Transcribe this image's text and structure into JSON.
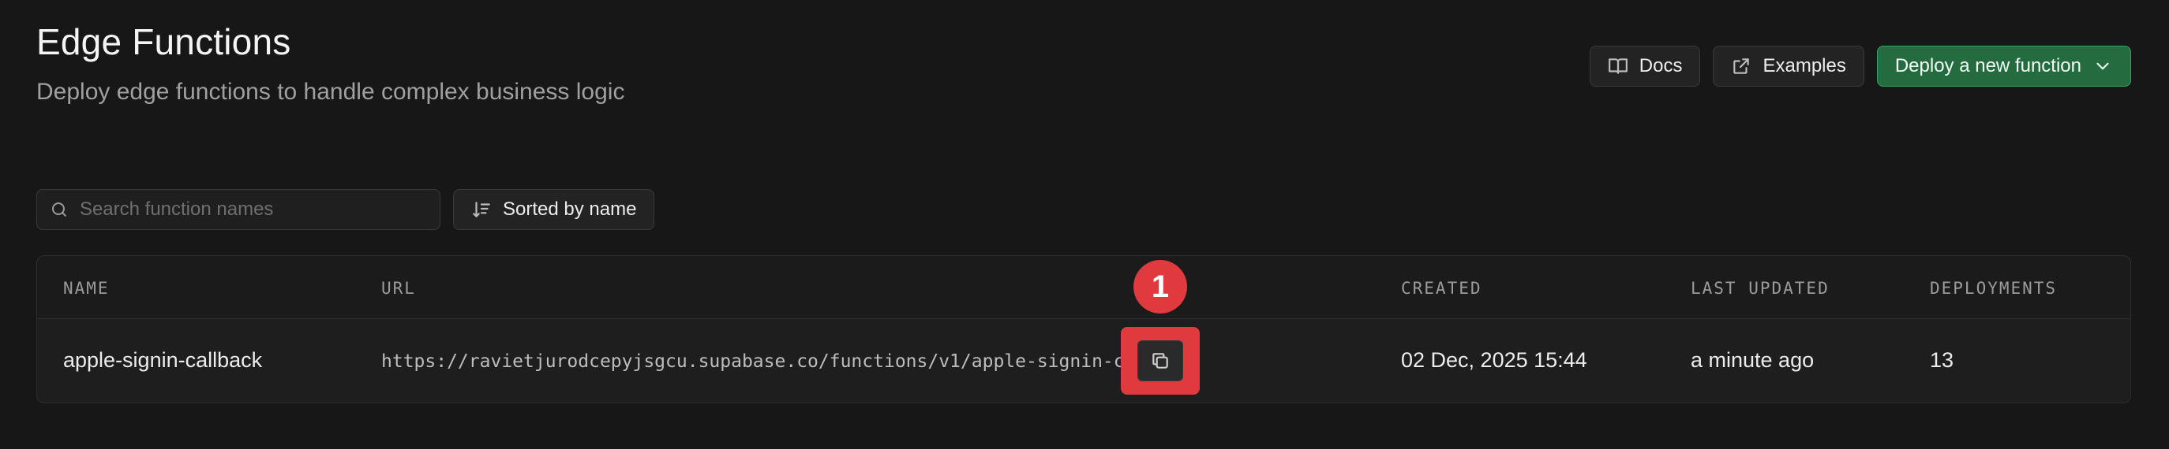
{
  "header": {
    "title": "Edge Functions",
    "subtitle": "Deploy edge functions to handle complex business logic"
  },
  "actions": {
    "docs_label": "Docs",
    "examples_label": "Examples",
    "deploy_label": "Deploy a new function"
  },
  "toolbar": {
    "search_placeholder": "Search function names",
    "search_value": "",
    "sort_label": "Sorted by name"
  },
  "table": {
    "columns": [
      "NAME",
      "URL",
      "CREATED",
      "LAST UPDATED",
      "DEPLOYMENTS"
    ],
    "rows": [
      {
        "name": "apple-signin-callback",
        "url": "https://ravietjurodcepyjsgcu.supabase.co/functions/v1/apple-signin-callback",
        "created": "02 Dec, 2025 15:44",
        "last_updated": "a minute ago",
        "deployments": "13"
      }
    ]
  },
  "annotation": {
    "badge": "1"
  },
  "colors": {
    "background": "#171717",
    "primary": "#246b3f",
    "highlight": "#e0393e"
  },
  "icons": {
    "docs": "book-icon",
    "examples": "external-link-icon",
    "deploy": "chevron-down-icon",
    "search": "search-icon",
    "sort": "sort-icon",
    "copy": "copy-icon"
  }
}
